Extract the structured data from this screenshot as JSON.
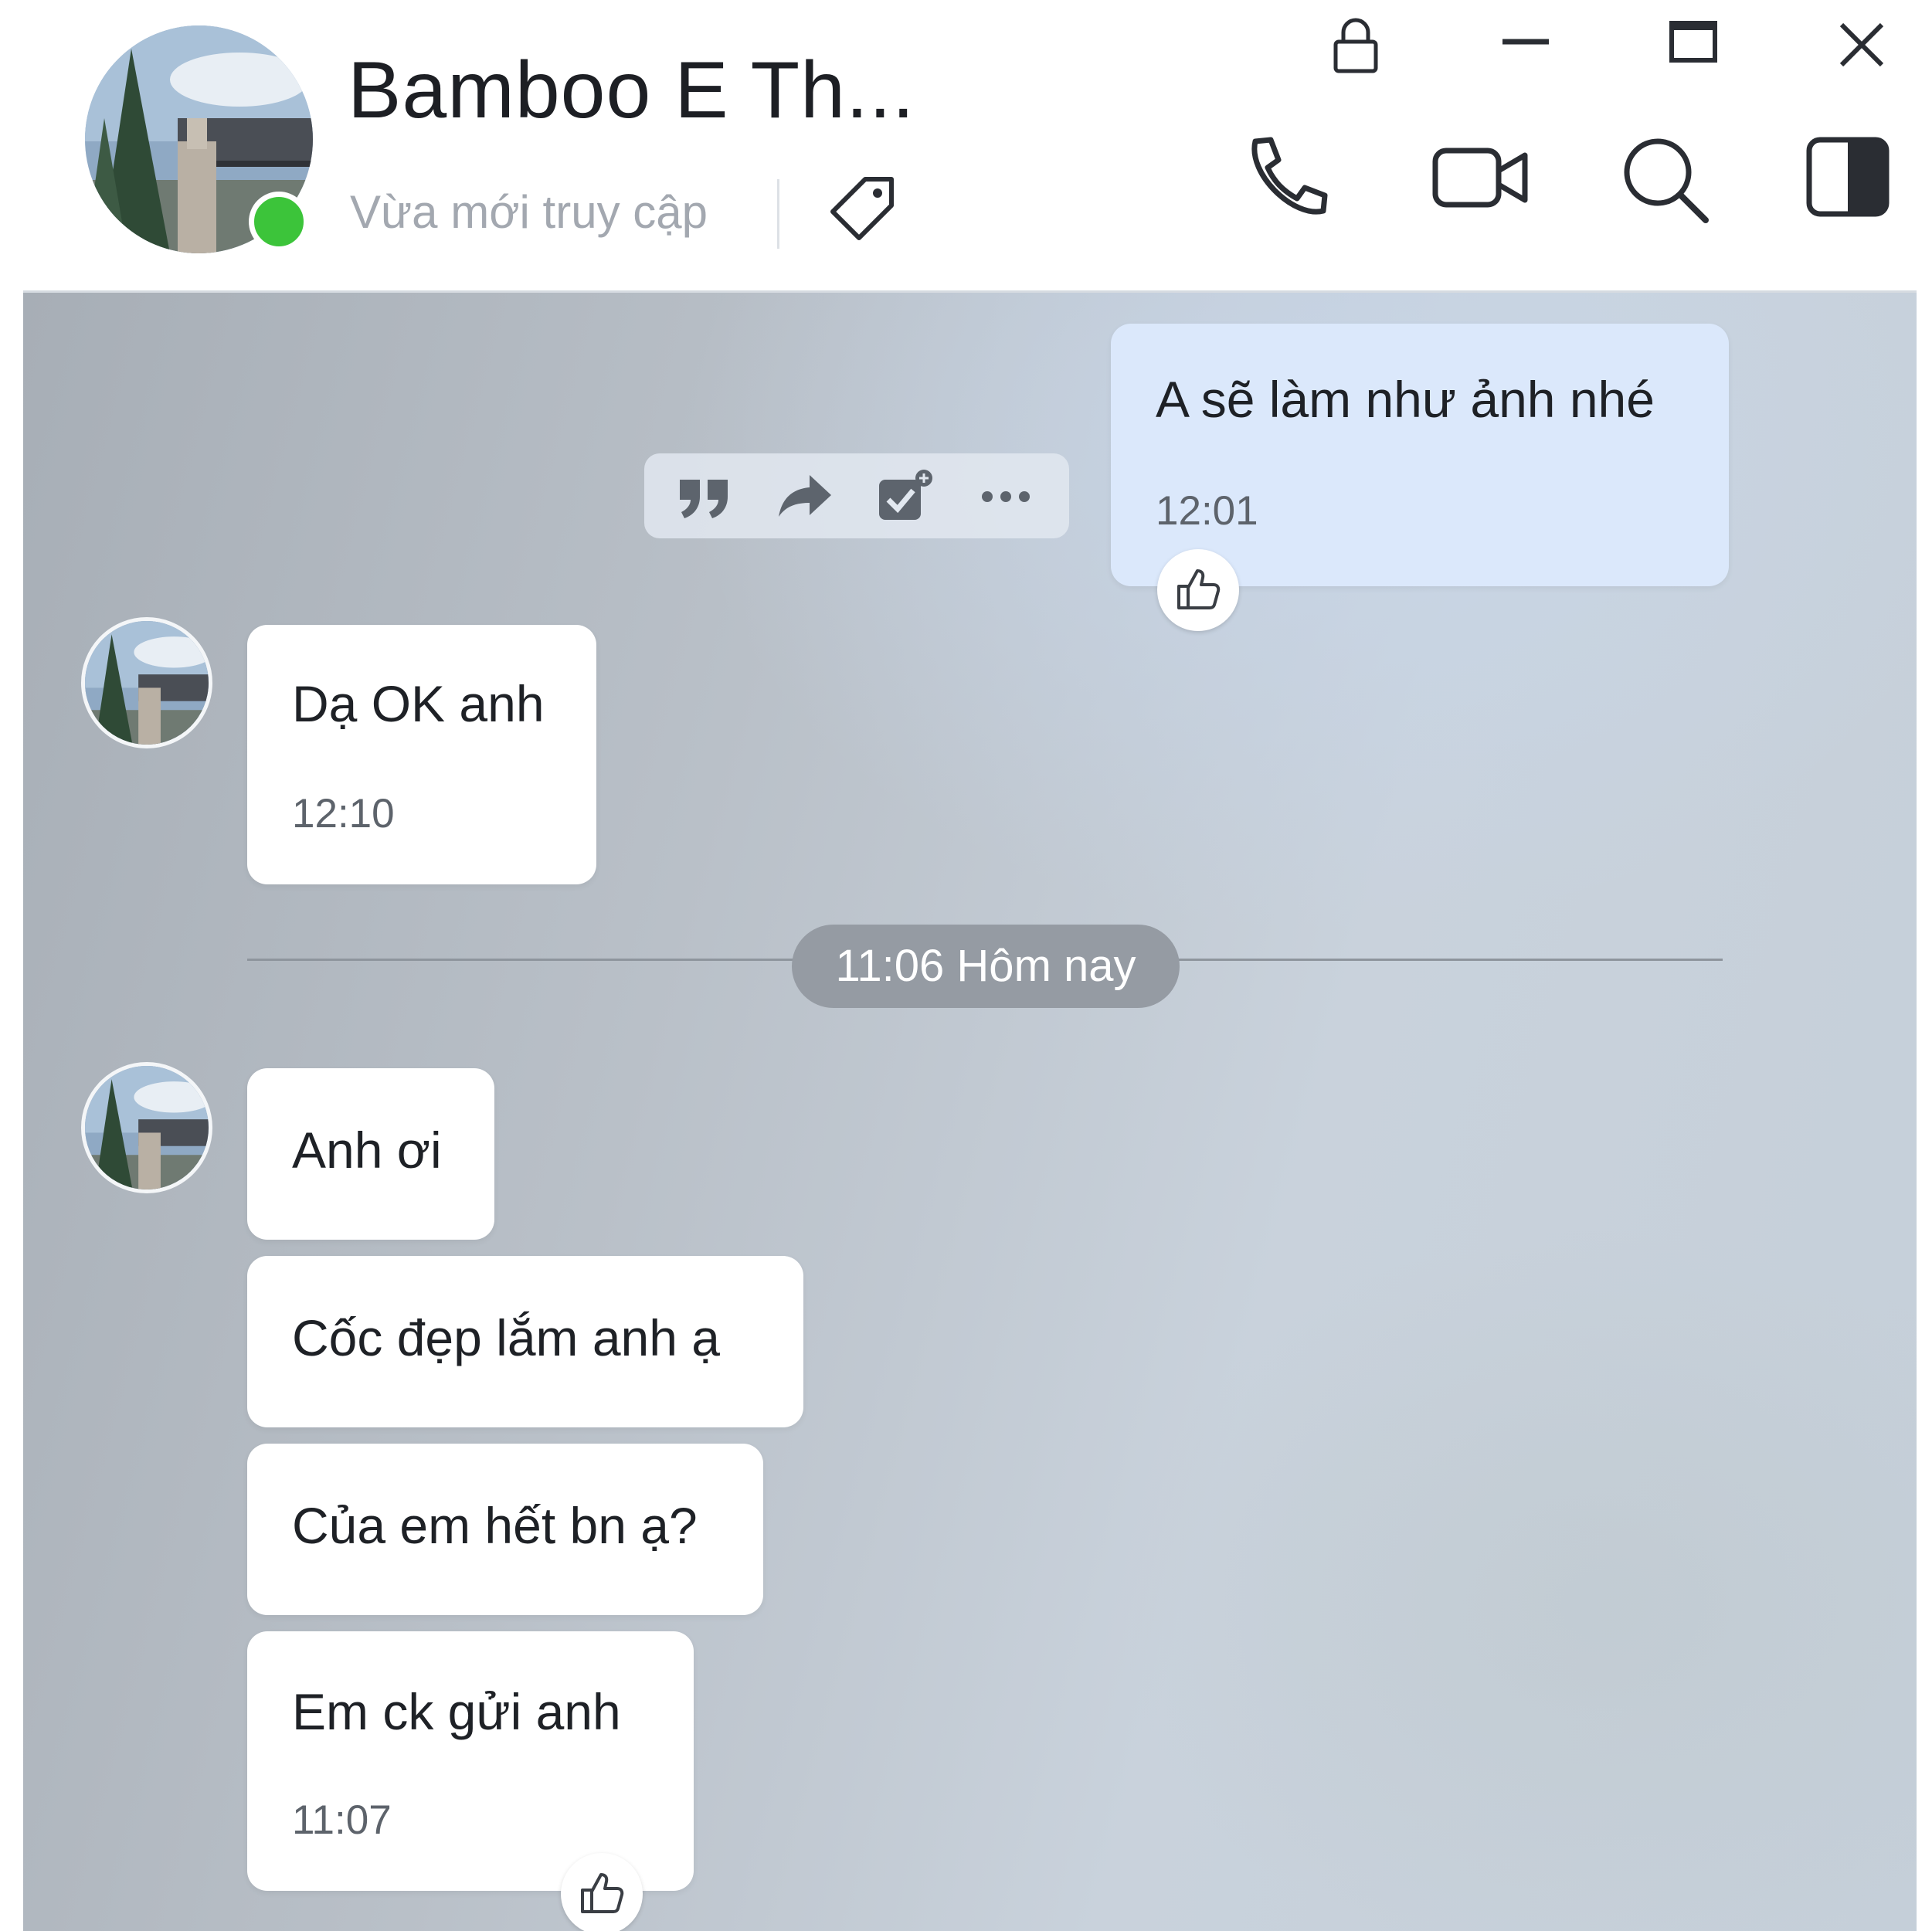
{
  "header": {
    "contact_name": "Bamboo E Th...",
    "status": "Vừa mới truy cập",
    "presence_color": "#3cc43a",
    "icons": {
      "tag": "tag-icon",
      "lock": "lock-icon",
      "minimize": "minimize-icon",
      "maximize": "maximize-icon",
      "close": "close-icon",
      "call": "phone-icon",
      "video": "video-camera-icon",
      "search": "search-icon",
      "panel": "side-panel-icon"
    }
  },
  "messages": {
    "outgoing_1": {
      "text": "A sẽ làm như ảnh nhé",
      "time": "12:01"
    },
    "incoming_1": {
      "text": "Dạ OK anh",
      "time": "12:10"
    },
    "incoming_2": {
      "text": "Anh ơi"
    },
    "incoming_3": {
      "text": "Cốc đẹp lắm anh ạ"
    },
    "incoming_4": {
      "text": "Của em hết bn ạ?"
    },
    "incoming_5": {
      "text": "Em ck gửi anh",
      "time": "11:07"
    }
  },
  "date_divider": {
    "label": "11:06 Hôm nay"
  },
  "message_toolbar": {
    "icons": [
      "quote-icon",
      "forward-icon",
      "add-task-icon",
      "more-icon"
    ]
  },
  "colors": {
    "outgoing_bubble": "#dbe8fb",
    "incoming_bubble": "#ffffff"
  }
}
